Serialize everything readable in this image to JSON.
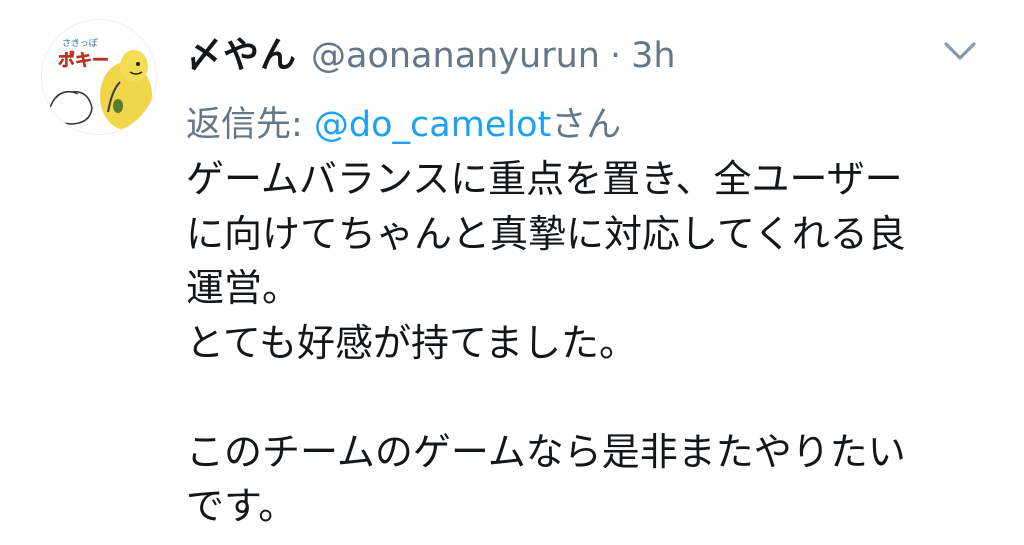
{
  "tweet": {
    "display_name": "〆やん",
    "handle": "@aonananyurun",
    "separator": "·",
    "time": "3h",
    "reply_prefix": "返信先: ",
    "reply_mention": "@do_camelot",
    "reply_suffix": "さん",
    "body_lines": [
      "ゲームバランスに重点を置き、全ユーザー",
      "に向けてちゃんと真摯に対応してくれる良",
      "運営。",
      "とても好感が持てました。",
      "",
      "このチームのゲームなら是非またやりたい",
      "です。"
    ]
  },
  "avatar": {
    "caption": "ポキー",
    "small_text": "さきっぽ"
  },
  "colors": {
    "text": "#14171a",
    "secondary": "#657786",
    "link": "#1da1f2"
  },
  "icons": {
    "menu": "chevron-down-icon"
  }
}
